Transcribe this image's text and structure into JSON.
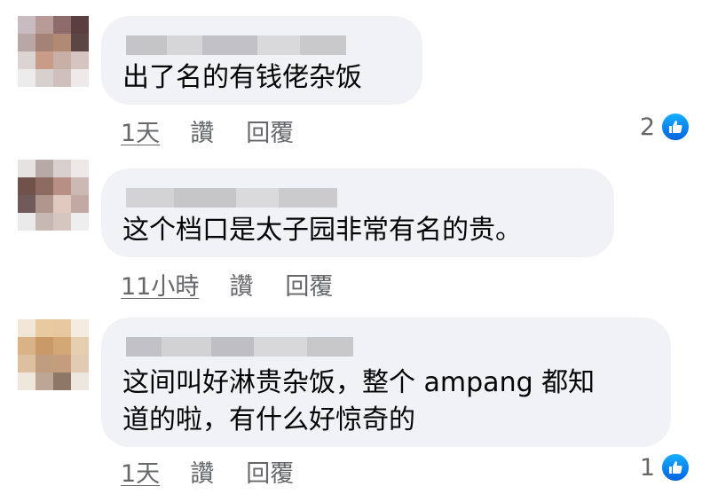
{
  "comments": [
    {
      "text": "出了名的有钱佬杂饭",
      "time": "1天",
      "like_label": "讚",
      "reply_label": "回覆",
      "reaction_count": "2",
      "avatar_colors": [
        "#c9bcc0",
        "#b89a97",
        "#8d6c6b",
        "#5b3e40",
        "#b9a7a8",
        "#a48376",
        "#b08a73",
        "#5c4643",
        "#dcd4d3",
        "#c89c86",
        "#c8b0a6",
        "#d5c4c2",
        "#ececec",
        "#d8cfcf",
        "#cfc0bd",
        "#eeeaea"
      ],
      "name_colors": [
        "#c5c5c8",
        "#d6d6d9",
        "#c2c2c6",
        "#d9d9dc",
        "#c9c9cc"
      ]
    },
    {
      "text": "这个档口是太子园非常有名的贵。",
      "time": "11小時",
      "like_label": "讚",
      "reply_label": "回覆",
      "reaction_count": "",
      "avatar_colors": [
        "#e6e2e1",
        "#b7a9a6",
        "#d9cfcd",
        "#ece9e8",
        "#70524a",
        "#8d6b62",
        "#b78f85",
        "#cdb9b4",
        "#6f5a59",
        "#b1968d",
        "#e2c9bf",
        "#c0aaa3",
        "#eaeaea",
        "#c6b8b3",
        "#d6c6c0",
        "#eeeeee"
      ],
      "name_colors": [
        "#d3d3d6",
        "#c6c6c9",
        "#dadadd",
        "#cbcbce"
      ]
    },
    {
      "text_line1": "这间叫好淋贵杂饭，整个 ampang 都知",
      "text_line2": "道的啦，有什么好惊奇的",
      "time": "1天",
      "like_label": "讚",
      "reply_label": "回覆",
      "reaction_count": "1",
      "avatar_colors": [
        "#f1e6d6",
        "#e9c9a0",
        "#e7c79f",
        "#f4ece0",
        "#d9b387",
        "#c99968",
        "#d4a777",
        "#e6cfb1",
        "#dcc0a0",
        "#bf9d7e",
        "#c49e7c",
        "#e1cbb3",
        "#f0e7dc",
        "#bca794",
        "#8d7766",
        "#ede6de"
      ],
      "name_colors": [
        "#c2c2c6",
        "#d2d2d5",
        "#bfbfc3",
        "#d8d8db",
        "#c8c8cb"
      ]
    }
  ],
  "accent_color": "#1877f2"
}
